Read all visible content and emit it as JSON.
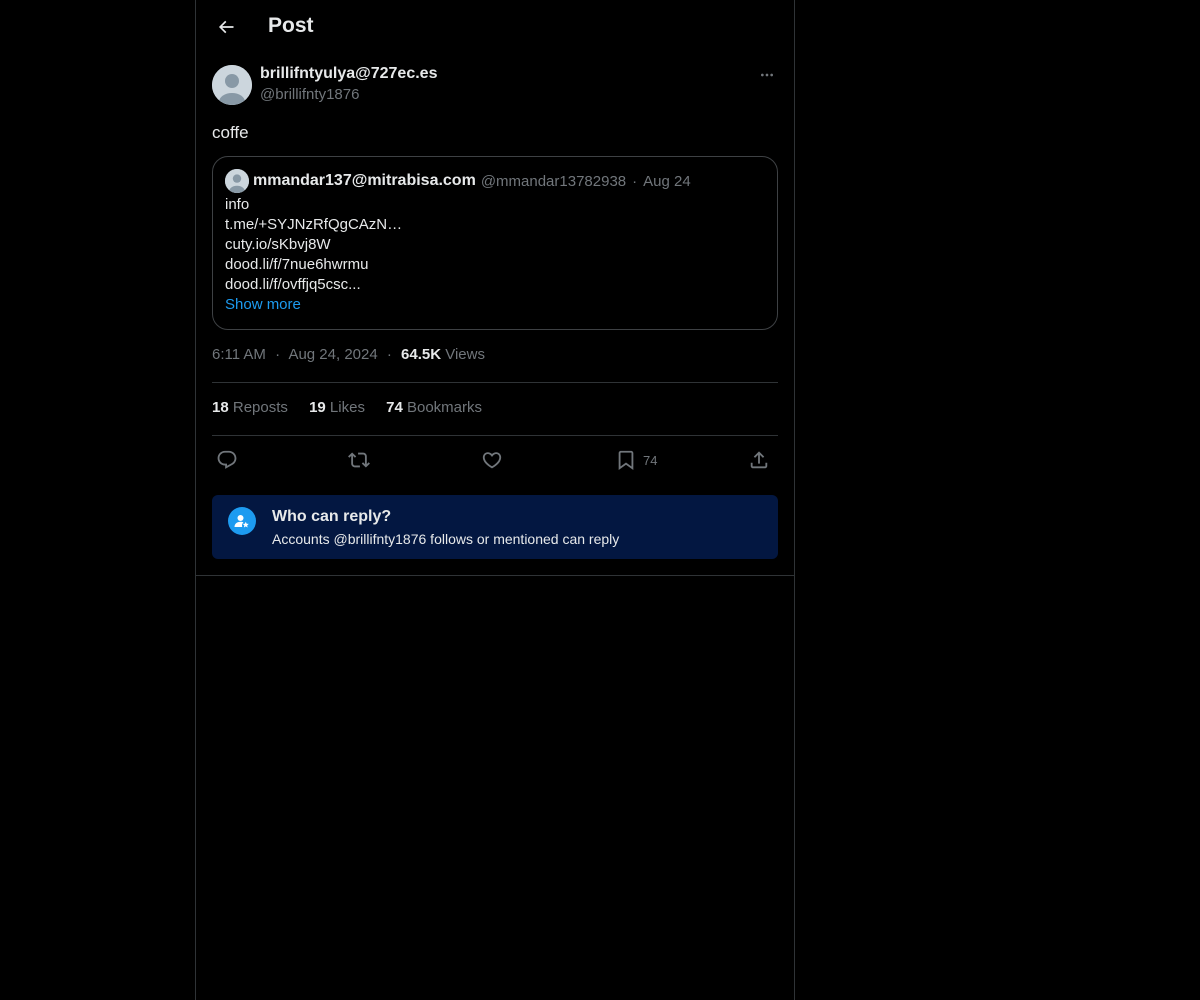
{
  "header": {
    "back_icon": "arrow-left-icon",
    "title": "Post"
  },
  "post": {
    "author_name": "brillifntyulya@727ec.es",
    "author_handle": "@brillifnty1876",
    "more_icon": "ellipsis-icon",
    "text": "coffe"
  },
  "quote": {
    "name": "mmandar137@mitrabisa.com",
    "handle": "@mmandar13782938",
    "separator": "·",
    "date": "Aug 24",
    "lines": [
      "info",
      "t.me/+SYJNzRfQgCAzN…",
      "cuty.io/sKbvj8W",
      "dood.li/f/7nue6hwrmu",
      "dood.li/f/ovffjq5csc..."
    ],
    "show_more": "Show more"
  },
  "meta": {
    "time": "6:11 AM",
    "sep1": "·",
    "date": "Aug 24, 2024",
    "sep2": "·",
    "views_count": "64.5K",
    "views_label": "Views"
  },
  "stats": {
    "reposts_count": "18",
    "reposts_label": "Reposts",
    "likes_count": "19",
    "likes_label": "Likes",
    "bookmarks_count": "74",
    "bookmarks_label": "Bookmarks"
  },
  "actions": {
    "reply_icon": "reply-icon",
    "repost_icon": "repost-icon",
    "like_icon": "heart-icon",
    "bookmark_icon": "bookmark-icon",
    "bookmark_count": "74",
    "share_icon": "share-icon"
  },
  "reply_restriction": {
    "title": "Who can reply?",
    "subtitle": "Accounts @brillifnty1876 follows or mentioned can reply"
  },
  "colors": {
    "background": "#000000",
    "border": "#2f3336",
    "text_primary": "#e7e9ea",
    "text_secondary": "#71767b",
    "accent": "#1d9bf0",
    "reply_box": "#031741"
  }
}
